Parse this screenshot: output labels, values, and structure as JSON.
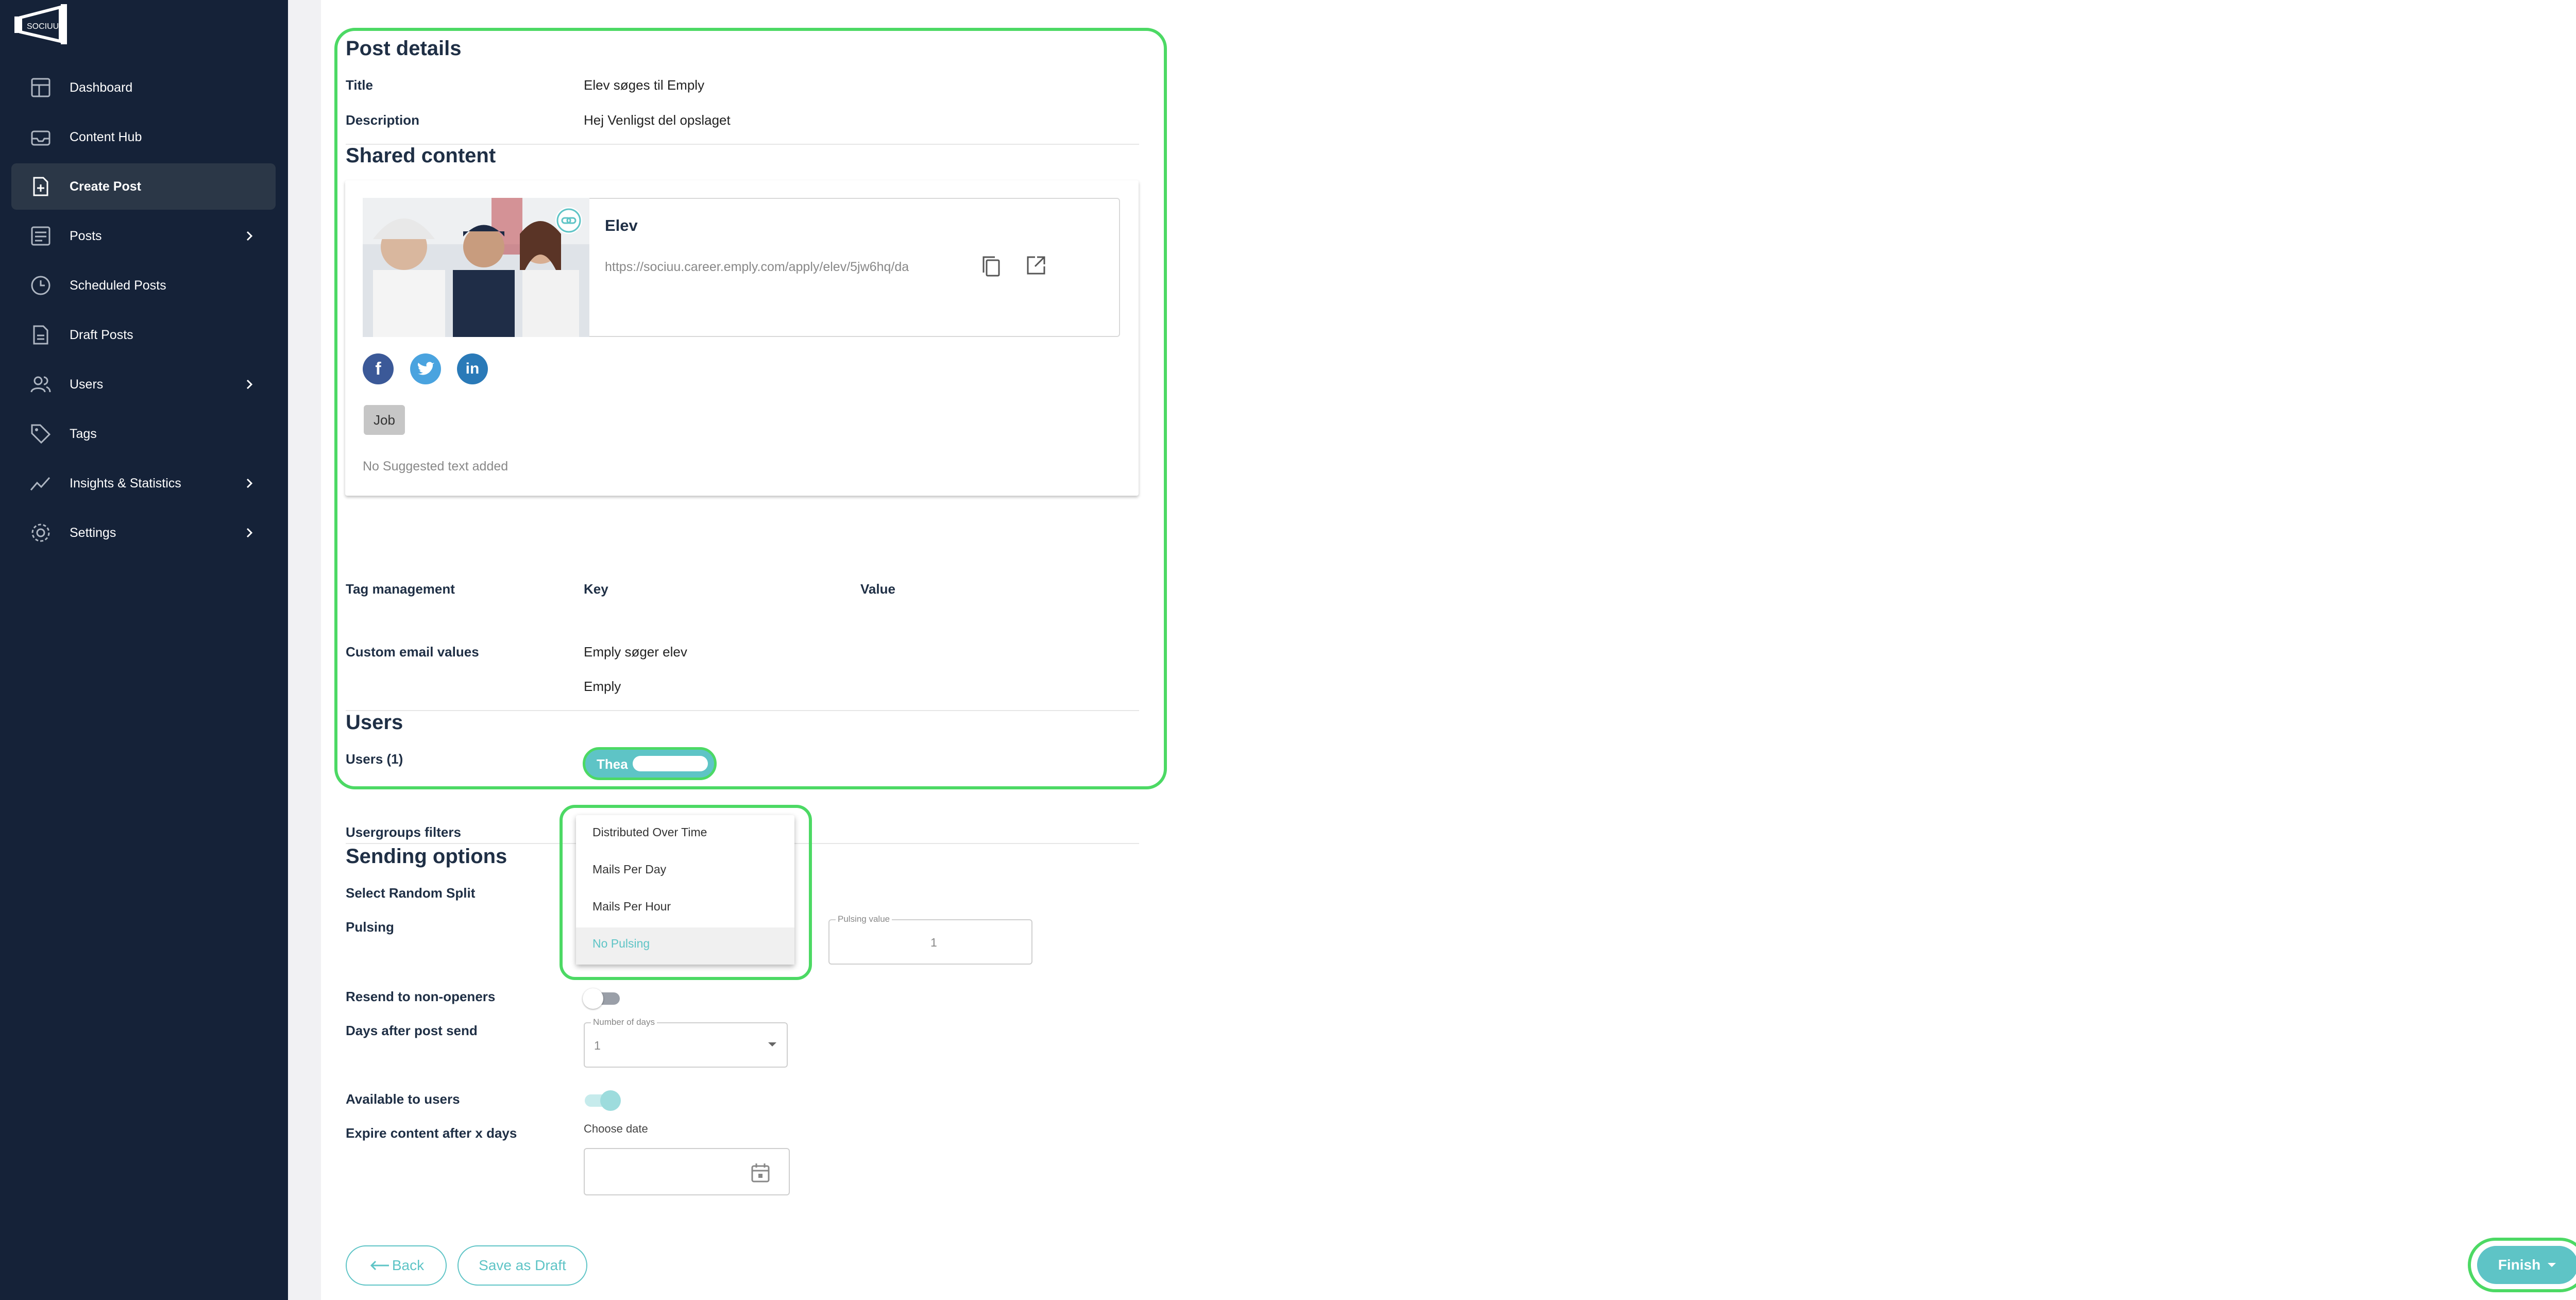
{
  "sidebar": {
    "logo_text": "SOCIUU",
    "items": [
      {
        "label": "Dashboard",
        "icon": "dashboard-icon"
      },
      {
        "label": "Content Hub",
        "icon": "inbox-icon"
      },
      {
        "label": "Create Post",
        "icon": "file-plus-icon",
        "active": true
      },
      {
        "label": "Posts",
        "icon": "posts-icon",
        "has_children": true
      },
      {
        "label": "Scheduled Posts",
        "icon": "clock-icon"
      },
      {
        "label": "Draft Posts",
        "icon": "document-icon"
      },
      {
        "label": "Users",
        "icon": "users-icon",
        "has_children": true
      },
      {
        "label": "Tags",
        "icon": "tag-icon"
      },
      {
        "label": "Insights & Statistics",
        "icon": "chart-line-icon",
        "has_children": true
      },
      {
        "label": "Settings",
        "icon": "gear-icon",
        "has_children": true
      }
    ]
  },
  "post_details": {
    "heading": "Post details",
    "title_label": "Title",
    "title_value": "Elev søges til Emply",
    "description_label": "Description",
    "description_value": "Hej Venligst del opslaget"
  },
  "shared_content": {
    "heading": "Shared content",
    "link_title": "Elev",
    "url": "https://sociuu.career.emply.com/apply/elev/5jw6hq/da",
    "tag_chip": "Job",
    "suggested_text": "No Suggested text added",
    "socials": [
      "facebook-icon",
      "twitter-icon",
      "linkedin-icon"
    ]
  },
  "tags": {
    "label": "Tag management",
    "key_header": "Key",
    "value_header": "Value",
    "custom_email_label": "Custom email values",
    "custom_email_values": [
      "Emply søger elev",
      "Emply"
    ]
  },
  "users": {
    "heading": "Users",
    "count_label": "Users (1)",
    "chip_name": "Thea"
  },
  "usergroups_label": "Usergroups filters",
  "sending": {
    "heading": "Sending options",
    "random_split_label": "Select Random Split",
    "pulsing_label": "Pulsing",
    "pulsing_options": [
      "Distributed Over Time",
      "Mails Per Day",
      "Mails Per Hour",
      "No Pulsing"
    ],
    "pulsing_selected": "No Pulsing",
    "pulsing_value_label": "Pulsing value",
    "pulsing_value": "1",
    "resend_label": "Resend to non-openers",
    "resend_enabled": false,
    "days_after_label": "Days after post send",
    "number_of_days_label": "Number of days",
    "number_of_days_value": "1",
    "available_label": "Available to users",
    "available_enabled": true,
    "expire_label": "Expire content after x days",
    "choose_date_label": "Choose date"
  },
  "buttons": {
    "back": "Back",
    "save_draft": "Save as Draft",
    "finish": "Finish"
  },
  "colors": {
    "sidebar_bg": "#152238",
    "accent": "#5ec4c6",
    "highlight": "#4cd964"
  }
}
